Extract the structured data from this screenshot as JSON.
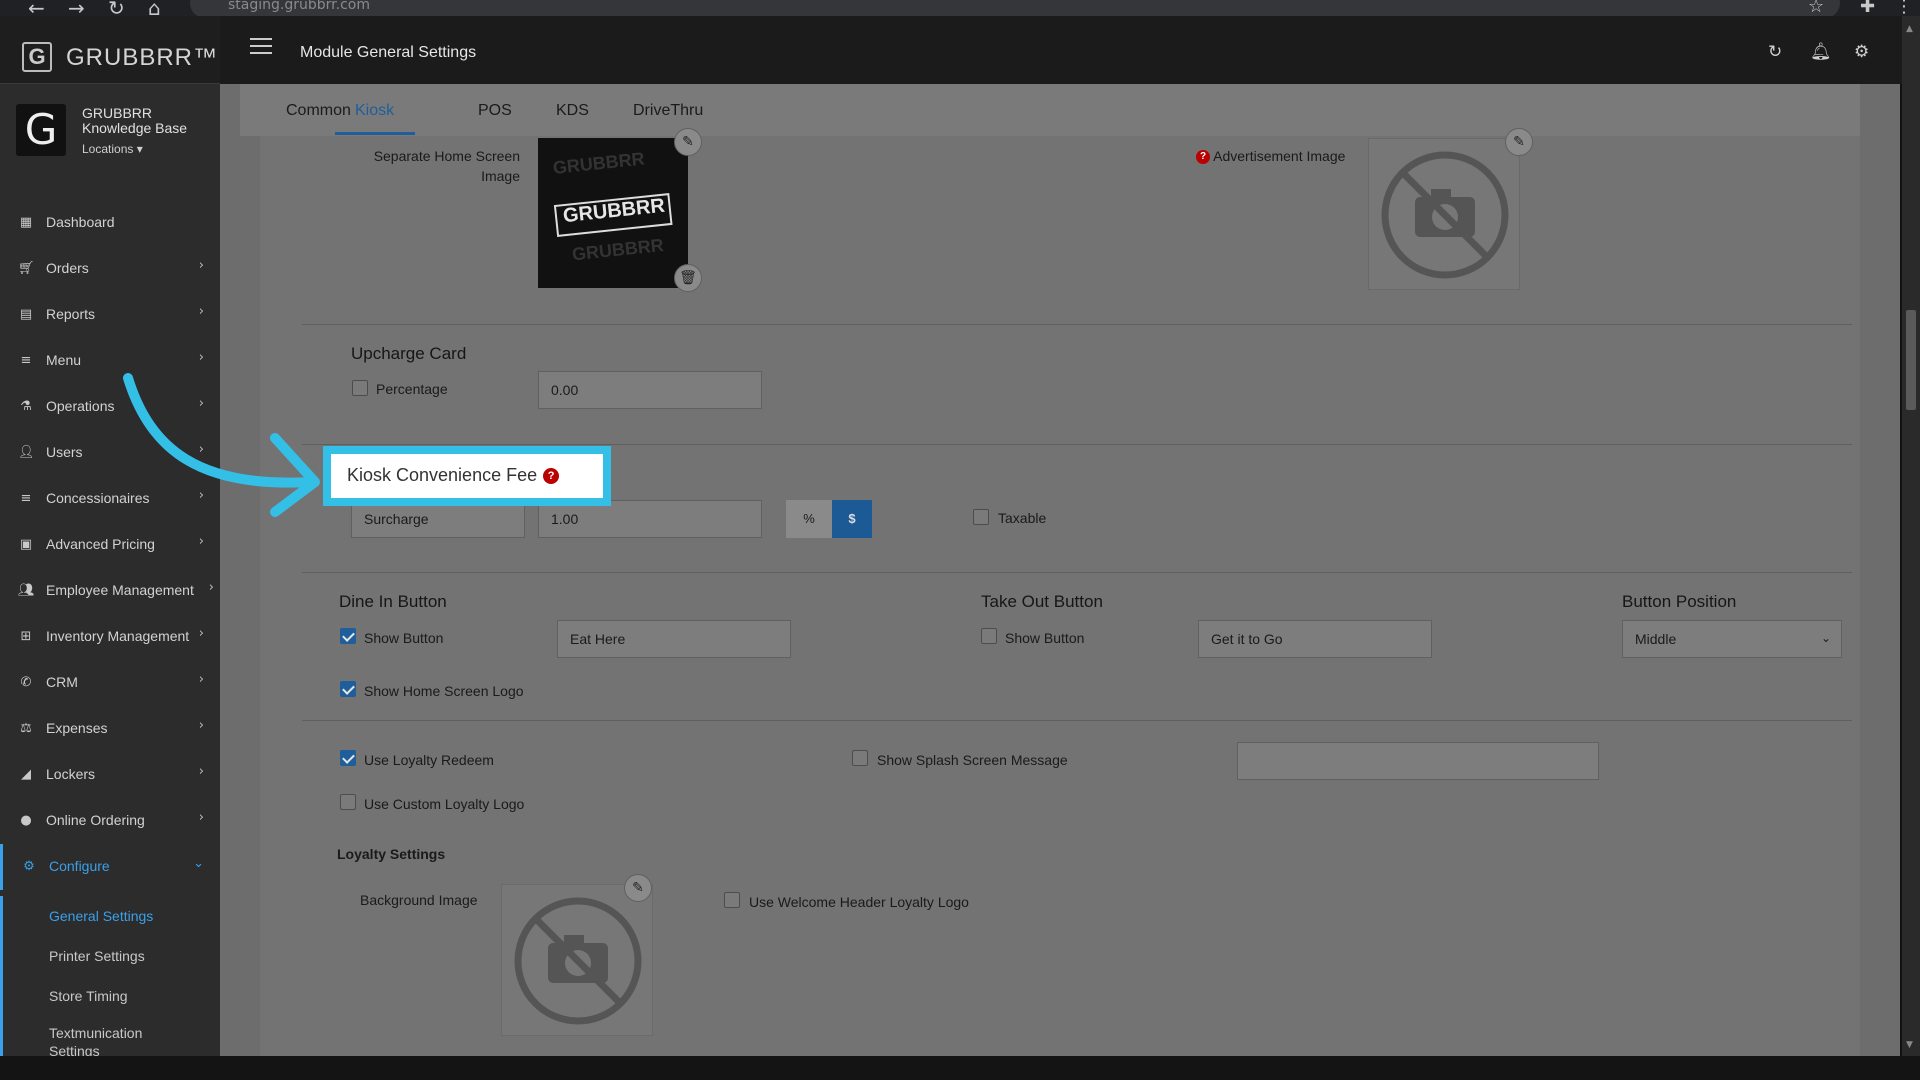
{
  "browser": {
    "url": "staging.grubbrr.com"
  },
  "brand": {
    "name": "GRUBBRR™",
    "logo_letter": "G"
  },
  "profile": {
    "name": "GRUBBRR Knowledge Base",
    "avatar_letter": "G",
    "locations_label": "Locations ▾"
  },
  "sidebar": {
    "items": [
      {
        "label": "Dashboard",
        "icon": "dashboard-icon",
        "has_chevron": false
      },
      {
        "label": "Orders",
        "icon": "cart-icon",
        "has_chevron": true
      },
      {
        "label": "Reports",
        "icon": "report-icon",
        "has_chevron": true
      },
      {
        "label": "Menu",
        "icon": "menu-icon",
        "has_chevron": true
      },
      {
        "label": "Operations",
        "icon": "flask-icon",
        "has_chevron": true
      },
      {
        "label": "Users",
        "icon": "user-plus-icon",
        "has_chevron": true
      },
      {
        "label": "Concessionaires",
        "icon": "list-icon",
        "has_chevron": true
      },
      {
        "label": "Advanced Pricing",
        "icon": "money-icon",
        "has_chevron": true
      },
      {
        "label": "Employee Management",
        "icon": "users-icon",
        "has_chevron": true
      },
      {
        "label": "Inventory Management",
        "icon": "sitemap-icon",
        "has_chevron": true
      },
      {
        "label": "CRM",
        "icon": "phone-icon",
        "has_chevron": true
      },
      {
        "label": "Expenses",
        "icon": "scale-icon",
        "has_chevron": true
      },
      {
        "label": "Lockers",
        "icon": "signal-icon",
        "has_chevron": true
      },
      {
        "label": "Online Ordering",
        "icon": "globe-icon",
        "has_chevron": true
      },
      {
        "label": "Configure",
        "icon": "gear-icon",
        "has_chevron": true,
        "active": true
      }
    ],
    "sub_items": [
      {
        "label": "General Settings",
        "active": true
      },
      {
        "label": "Printer Settings"
      },
      {
        "label": "Store Timing"
      },
      {
        "label": "Textmunication Settings"
      }
    ]
  },
  "header": {
    "title": "Module General Settings"
  },
  "tabs": [
    {
      "label": "Common"
    },
    {
      "label": "Kiosk",
      "active": true
    },
    {
      "label": "POS"
    },
    {
      "label": "KDS"
    },
    {
      "label": "DriveThru"
    }
  ],
  "home_screen": {
    "separate_image_label": "Separate Home Screen Image",
    "image_brand_text": "GRUBBRR",
    "advertisement_label": "Advertisement Image"
  },
  "upcharge": {
    "title": "Upcharge Card",
    "percentage_label": "Percentage",
    "percentage_checked": false,
    "value": "0.00"
  },
  "convenience_fee": {
    "title": "Kiosk Convenience Fee",
    "type_value": "Surcharge",
    "amount": "1.00",
    "percent_label": "%",
    "dollar_label": "$",
    "active_unit": "$",
    "taxable_label": "Taxable",
    "taxable_checked": false
  },
  "dine_in": {
    "title": "Dine In Button",
    "show_button_label": "Show Button",
    "show_button_checked": true,
    "button_text": "Eat Here",
    "show_logo_label": "Show Home Screen Logo",
    "show_logo_checked": true
  },
  "take_out": {
    "title": "Take Out Button",
    "show_button_label": "Show Button",
    "show_button_checked": false,
    "button_text": "Get it to Go"
  },
  "button_position": {
    "title": "Button Position",
    "selected": "Middle"
  },
  "loyalty": {
    "use_redeem_label": "Use Loyalty Redeem",
    "use_redeem_checked": true,
    "custom_logo_label": "Use Custom Loyalty Logo",
    "custom_logo_checked": false,
    "splash_label": "Show Splash Screen Message",
    "splash_checked": false,
    "splash_value": "",
    "settings_title": "Loyalty Settings",
    "background_image_label": "Background Image",
    "welcome_header_label": "Use Welcome Header Loyalty Logo",
    "welcome_header_checked": false
  },
  "colors": {
    "accent": "#33bfe6",
    "primary": "#1f5e9a",
    "sidebar_active": "#3aa0ea"
  }
}
